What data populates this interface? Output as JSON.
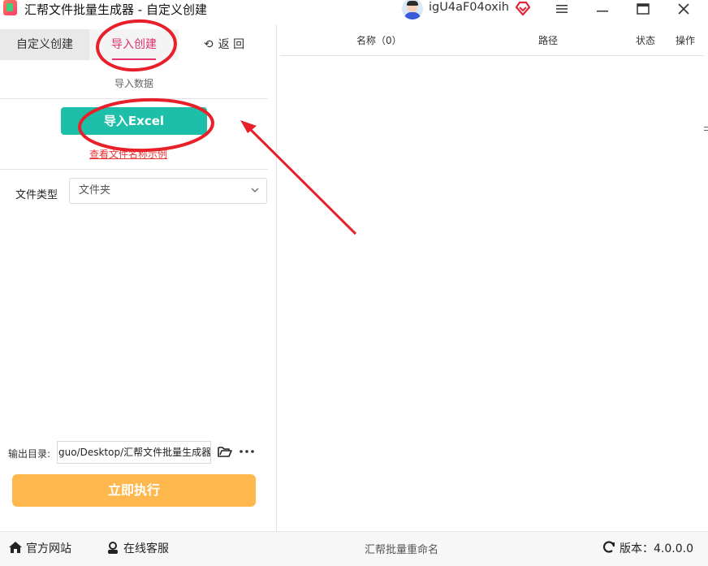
{
  "window": {
    "title": "汇帮文件批量生成器 - 自定义创建",
    "username": "igU4aF04oxih",
    "icons": {
      "app": "app-logo-icon",
      "vip": "vip-diamond-icon",
      "menu": "hamburger-menu-icon",
      "minimize": "minimize-icon",
      "maximize": "maximize-icon",
      "close": "close-icon"
    }
  },
  "tabs": [
    {
      "label": "自定义创建",
      "active": false
    },
    {
      "label": "导入创建",
      "active": true
    },
    {
      "label": "返  回",
      "icon": "undo-arrow-icon"
    }
  ],
  "import_section": {
    "title": "导入数据",
    "import_button": "导入Excel",
    "example_link": "查看文件名称示例"
  },
  "file_type": {
    "label": "文件类型",
    "selected": "文件夹"
  },
  "output": {
    "label": "输出目录:",
    "path": "guo/Desktop/汇帮文件批量生成器",
    "folder_icon": "folder-open-icon",
    "more_icon": "ellipsis-icon"
  },
  "run_button": "立即执行",
  "table": {
    "columns": [
      "名称（0）",
      "路径",
      "状态",
      "操作"
    ],
    "rows": []
  },
  "statusbar": {
    "home": "官方网站",
    "support": "在线客服",
    "center": "汇帮批量重命名",
    "version_label": "版本：",
    "version": "4.0.0.0"
  },
  "colors": {
    "accent_pink": "#e2336b",
    "import_button": "#1dbfa8",
    "run_button": "#ffb84d",
    "annotation_red": "#e8202a"
  }
}
